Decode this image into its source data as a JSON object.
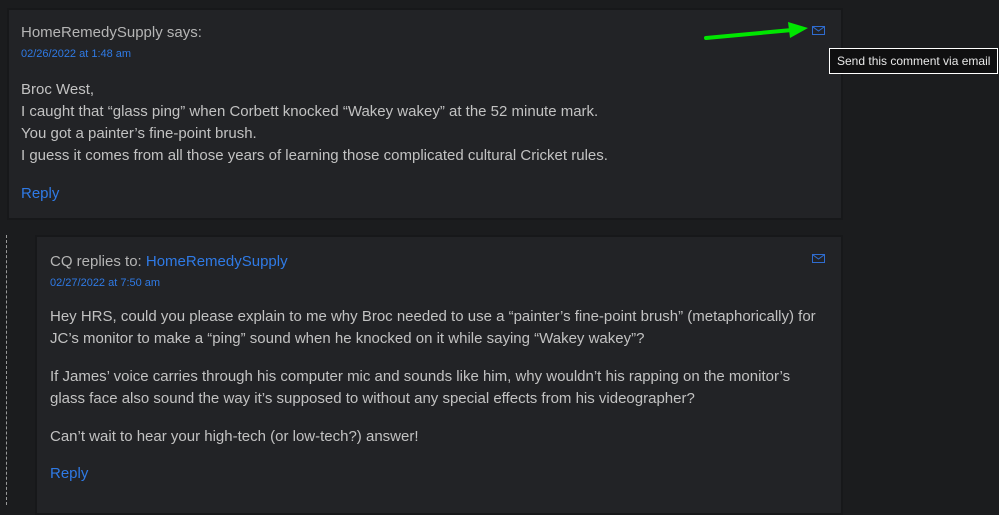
{
  "comments": [
    {
      "header": "HomeRemedySupply says:",
      "date": "02/26/2022 at 1:48 am",
      "paragraphs": [
        "Broc West,",
        "I caught that “glass ping” when Corbett knocked “Wakey wakey” at the 52 minute mark.",
        "You got a painter’s fine-point brush.",
        "I guess it comes from all those years of learning those complicated cultural Cricket rules."
      ],
      "reply_label": "Reply",
      "email_icon": "envelope-icon"
    },
    {
      "header_prefix": "CQ replies to: ",
      "header_link": "HomeRemedySupply",
      "date": "02/27/2022 at 7:50 am",
      "paragraphs": [
        "Hey HRS, could you please explain to me why Broc needed to use a “painter’s fine-point brush” (metaphorically) for JC’s monitor to make a “ping” sound when he knocked on it while saying “Wakey wakey”?",
        "If James’ voice carries through his computer mic and sounds like him, why wouldn’t his rapping on the monitor’s glass face also sound the way it’s supposed to without any special effects from his videographer?",
        "Can’t wait to hear your high-tech (or low-tech?) answer!"
      ],
      "reply_label": "Reply",
      "email_icon": "envelope-icon"
    }
  ],
  "tooltip": "Send this comment via email",
  "annotation": {
    "type": "arrow",
    "color": "#00e600"
  },
  "colors": {
    "link": "#2f7ae5",
    "background": "#1b1c1e",
    "card": "#222326"
  }
}
